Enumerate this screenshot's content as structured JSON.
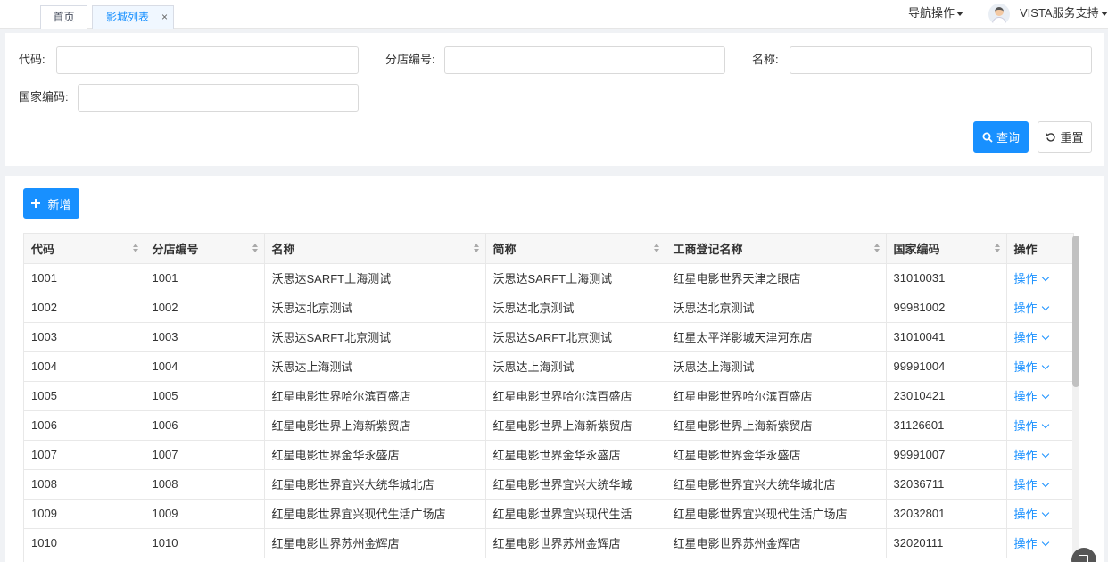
{
  "tabs": {
    "home": "首页",
    "active": "影城列表",
    "close": "×"
  },
  "header": {
    "nav_ops": "导航操作",
    "user": "VISTA服务支持"
  },
  "search": {
    "code_label": "代码:",
    "branch_label": "分店编号:",
    "name_label": "名称:",
    "country_label": "国家编码:",
    "query": "查询",
    "reset": "重置"
  },
  "toolbar": {
    "add": "新增"
  },
  "table": {
    "headers": [
      "代码",
      "分店编号",
      "名称",
      "简称",
      "工商登记名称",
      "国家编码",
      "操作"
    ],
    "op_label": "操作",
    "rows": [
      [
        "1001",
        "1001",
        "沃思达SARFT上海测试",
        "沃思达SARFT上海测试",
        "红星电影世界天津之眼店",
        "31010031"
      ],
      [
        "1002",
        "1002",
        "沃思达北京测试",
        "沃思达北京测试",
        "沃思达北京测试",
        "99981002"
      ],
      [
        "1003",
        "1003",
        "沃思达SARFT北京测试",
        "沃思达SARFT北京测试",
        "红星太平洋影城天津河东店",
        "31010041"
      ],
      [
        "1004",
        "1004",
        "沃思达上海测试",
        "沃思达上海测试",
        "沃思达上海测试",
        "99991004"
      ],
      [
        "1005",
        "1005",
        "红星电影世界哈尔滨百盛店",
        "红星电影世界哈尔滨百盛店",
        "红星电影世界哈尔滨百盛店",
        "23010421"
      ],
      [
        "1006",
        "1006",
        "红星电影世界上海新紫贸店",
        "红星电影世界上海新紫贸店",
        "红星电影世界上海新紫贸店",
        "31126601"
      ],
      [
        "1007",
        "1007",
        "红星电影世界金华永盛店",
        "红星电影世界金华永盛店",
        "红星电影世界金华永盛店",
        "99991007"
      ],
      [
        "1008",
        "1008",
        "红星电影世界宜兴大统华城北店",
        "红星电影世界宜兴大统华城",
        "红星电影世界宜兴大统华城北店",
        "32036711"
      ],
      [
        "1009",
        "1009",
        "红星电影世界宜兴现代生活广场店",
        "红星电影世界宜兴现代生活",
        "红星电影世界宜兴现代生活广场店",
        "32032801"
      ],
      [
        "1010",
        "1010",
        "红星电影世界苏州金辉店",
        "红星电影世界苏州金辉店",
        "红星电影世界苏州金辉店",
        "32020111"
      ]
    ]
  },
  "colors": {
    "primary": "#1890ff"
  }
}
